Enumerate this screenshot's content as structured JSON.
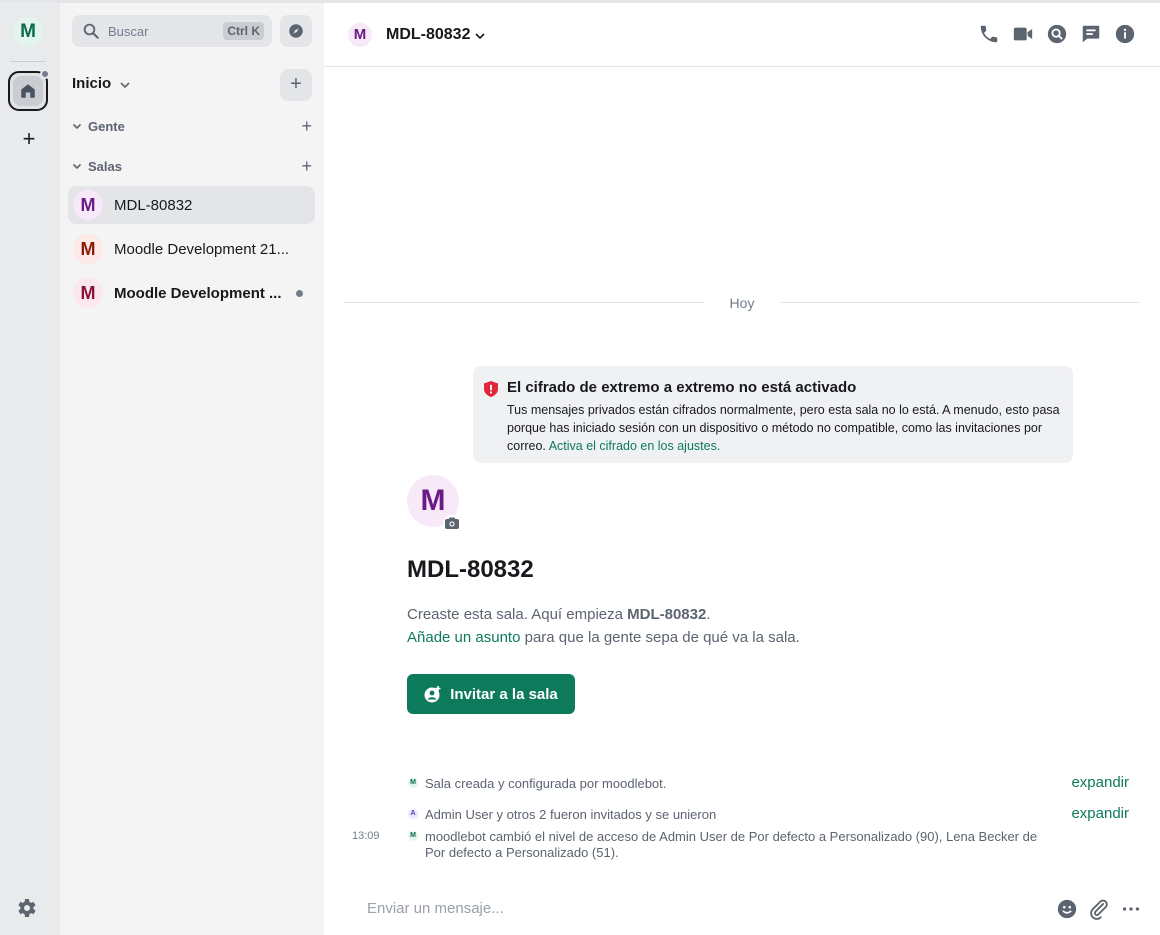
{
  "spacebar": {
    "space_initial": "M",
    "add_label": "+"
  },
  "roomlist": {
    "search_placeholder": "Buscar",
    "search_shortcut": "Ctrl K",
    "home_title": "Inicio",
    "home_add": "+",
    "sections": [
      {
        "label": "Gente",
        "add": "+"
      },
      {
        "label": "Salas",
        "add": "+"
      }
    ],
    "rooms": [
      {
        "initial": "M",
        "name": "MDL-80832",
        "active": true,
        "bold": false,
        "unread": false,
        "avatar_bg": "#f7e9f8",
        "avatar_fg": "#6b1a86"
      },
      {
        "initial": "M",
        "name": "Moodle Development 21...",
        "active": false,
        "bold": false,
        "unread": false,
        "avatar_bg": "#fde9e6",
        "avatar_fg": "#8b1a0a"
      },
      {
        "initial": "M",
        "name": "Moodle Development ...",
        "active": false,
        "bold": true,
        "unread": true,
        "avatar_bg": "#fbe8ee",
        "avatar_fg": "#86123a"
      }
    ]
  },
  "header": {
    "avatar_initial": "M",
    "title": "MDL-80832"
  },
  "timeline": {
    "day_label": "Hoy",
    "e2e": {
      "title": "El cifrado de extremo a extremo no está activado",
      "body": "Tus mensajes privados están cifrados normalmente, pero esta sala no lo está. A menudo, esto pasa porque has iniciado sesión con un dispositivo o método no compatible, como las invitaciones por correo. ",
      "link": "Activa el cifrado en los ajustes."
    },
    "room_avatar_initial": "M",
    "room_title": "MDL-80832",
    "intro_prefix": "Creaste esta sala. Aquí empieza ",
    "intro_room": "MDL-80832",
    "intro_suffix": ".",
    "topic_link": "Añade un asunto",
    "topic_suffix": " para que la gente sepa de qué va la sala.",
    "invite_label": "Invitar a la sala",
    "events": [
      {
        "avatar": "M",
        "text": "Sala creada y configurada por moodlebot.",
        "expand": "expandir",
        "time": ""
      },
      {
        "avatar": "A",
        "text": "Admin User y otros 2 fueron invitados y se unieron",
        "expand": "expandir",
        "time": ""
      },
      {
        "avatar": "M",
        "text": "moodlebot cambió el nivel de acceso de Admin User de Por defecto a Personalizado (90), Lena Becker de Por defecto a Personalizado (51).",
        "expand": "",
        "time": "13:09"
      }
    ]
  },
  "composer": {
    "placeholder": "Enviar un mensaje..."
  },
  "colors": {
    "accent": "#0d7a5c",
    "alert": "#e0263a"
  }
}
